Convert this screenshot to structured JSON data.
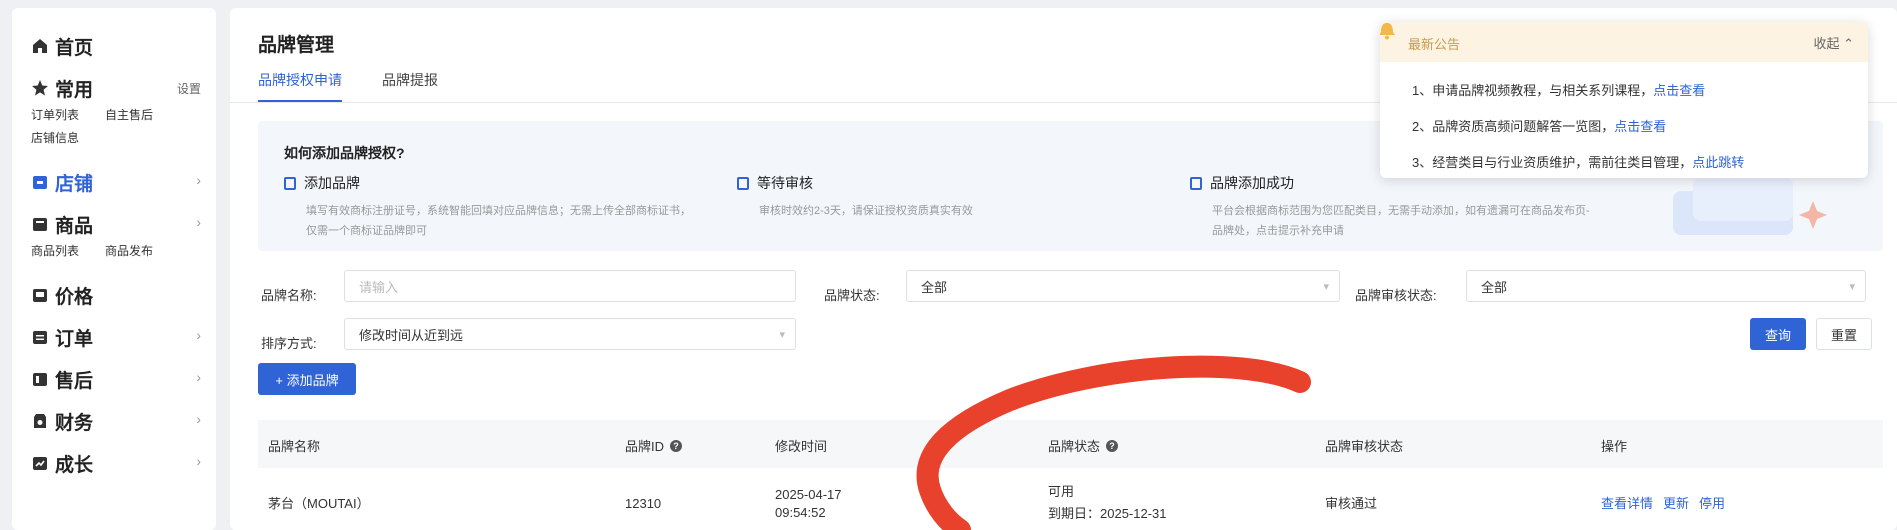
{
  "sidebar": {
    "items": [
      {
        "label": "首页",
        "icon": "home-icon",
        "subs": []
      },
      {
        "label": "常用",
        "icon": "star-icon",
        "extra": "设置",
        "subs": [
          "订单列表",
          "自主售后",
          "店铺信息"
        ]
      },
      {
        "label": "店铺",
        "icon": "store-icon",
        "active": true,
        "chevron": "›",
        "subs": []
      },
      {
        "label": "商品",
        "icon": "goods-icon",
        "chevron": "›",
        "subs": [
          "商品列表",
          "商品发布"
        ]
      },
      {
        "label": "价格",
        "icon": "price-icon",
        "subs": []
      },
      {
        "label": "订单",
        "icon": "order-icon",
        "chevron": "›",
        "subs": []
      },
      {
        "label": "售后",
        "icon": "aftersale-icon",
        "chevron": "›",
        "subs": []
      },
      {
        "label": "财务",
        "icon": "finance-icon",
        "chevron": "›",
        "subs": []
      },
      {
        "label": "成长",
        "icon": "growth-icon",
        "chevron": "›",
        "subs": []
      }
    ]
  },
  "page": {
    "title": "品牌管理",
    "tabs": [
      {
        "label": "品牌授权申请",
        "active": true
      },
      {
        "label": "品牌提报",
        "active": false
      }
    ]
  },
  "guide": {
    "title": "如何添加品牌授权?",
    "steps": [
      {
        "title": "添加品牌",
        "desc": "填写有效商标注册证号，系统智能回填对应品牌信息；无需上传全部商标证书，仅需一个商标证品牌即可"
      },
      {
        "title": "等待审核",
        "desc": "审核时效约2-3天，请保证授权资质真实有效"
      },
      {
        "title": "品牌添加成功",
        "desc": "平台会根据商标范围为您匹配类目，无需手动添加，如有遗漏可在商品发布页-品牌处，点击提示补充申请"
      }
    ]
  },
  "filters": {
    "brand_name_label": "品牌名称:",
    "brand_name_placeholder": "请输入",
    "brand_status_label": "品牌状态:",
    "brand_status_value": "全部",
    "audit_status_label": "品牌审核状态:",
    "audit_status_value": "全部",
    "sort_label": "排序方式:",
    "sort_value": "修改时间从近到远",
    "search_btn": "查询",
    "reset_btn": "重置",
    "add_btn": "+ 添加品牌"
  },
  "table": {
    "headers": [
      "品牌名称",
      "品牌ID",
      "修改时间",
      "品牌状态",
      "品牌审核状态",
      "操作"
    ],
    "help_mark": "?",
    "rows": [
      {
        "name": "茅台（MOUTAI）",
        "id": "12310",
        "date": "2025-04-17",
        "time": "09:54:52",
        "status": "可用",
        "expiry": "到期日：2025-12-31",
        "audit": "审核通过",
        "actions": [
          "查看详情",
          "更新",
          "停用"
        ]
      }
    ]
  },
  "notice": {
    "title": "最新公告",
    "collapse": "收起 ⌃",
    "items": [
      {
        "text": "1、申请品牌视频教程，与相关系列课程，",
        "link": "点击查看"
      },
      {
        "text": "2、品牌资质高频问题解答一览图，",
        "link": "点击查看"
      },
      {
        "text": "3、经营类目与行业资质维护，需前往类目管理，",
        "link": "点此跳转"
      }
    ]
  },
  "colors": {
    "accent": "#2f63d6",
    "annotation": "#e8412c"
  }
}
